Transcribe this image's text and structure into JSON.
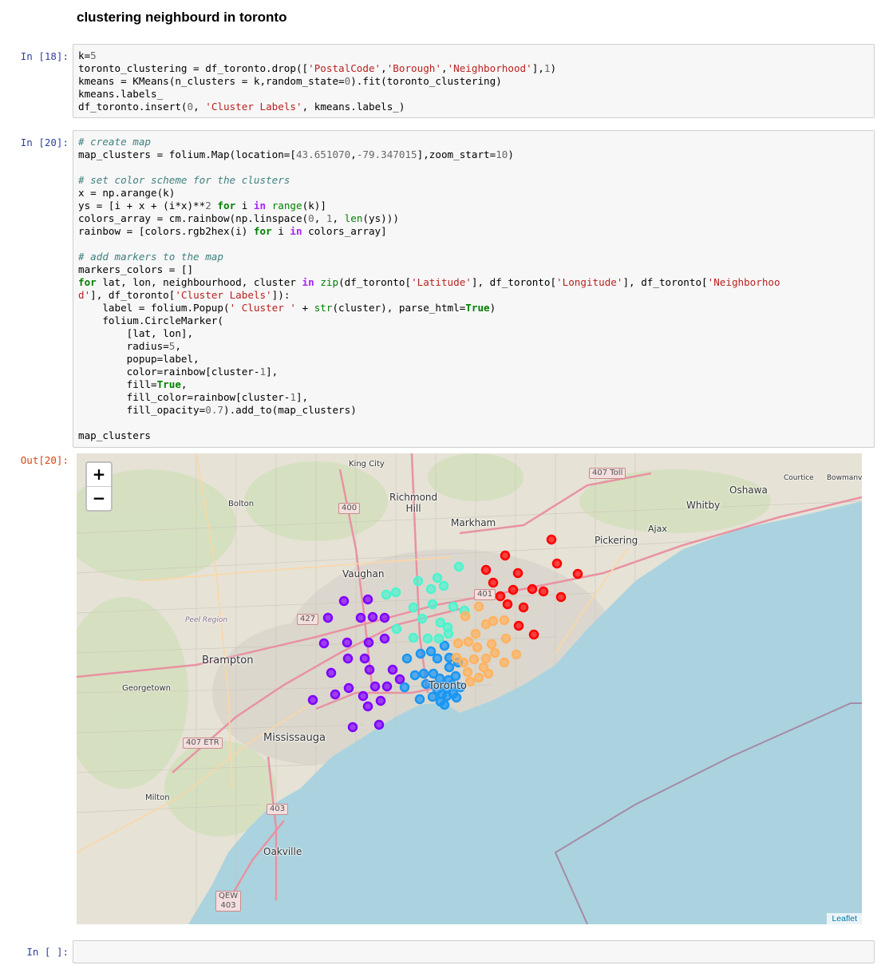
{
  "heading": "clustering neighbourd in toronto",
  "cells": {
    "c18": {
      "prompt": "In [18]:"
    },
    "c20": {
      "prompt": "In [20]:",
      "out_prompt": "Out[20]:"
    },
    "empty": {
      "prompt": "In [ ]:"
    }
  },
  "map": {
    "zoom_in": "+",
    "zoom_out": "−",
    "attribution": "Leaflet",
    "place_labels": {
      "king_city": "King City",
      "richmond_hill": "Richmond\nHill",
      "markham": "Markham",
      "bolton": "Bolton",
      "vaughan": "Vaughan",
      "pickering": "Pickering",
      "ajax": "Ajax",
      "whitby": "Whitby",
      "oshawa": "Oshawa",
      "courtice": "Courtice",
      "bowmanville": "Bowmanv",
      "peel_region": "Peel Region",
      "brampton": "Brampton",
      "georgetown": "Georgetown",
      "toronto": "Toronto",
      "mississauga": "Mississauga",
      "milton": "Milton",
      "oakville": "Oakville"
    },
    "highway_shields": {
      "h407toll": "407 Toll",
      "h400": "400",
      "h401": "401",
      "h427": "427",
      "h407etr": "407 ETR",
      "h403": "403",
      "qew": "QEW\n403"
    },
    "cluster_colors": [
      "#8000ff",
      "#1996f3",
      "#4df3ce",
      "#ffb360",
      "#ff0000"
    ]
  }
}
